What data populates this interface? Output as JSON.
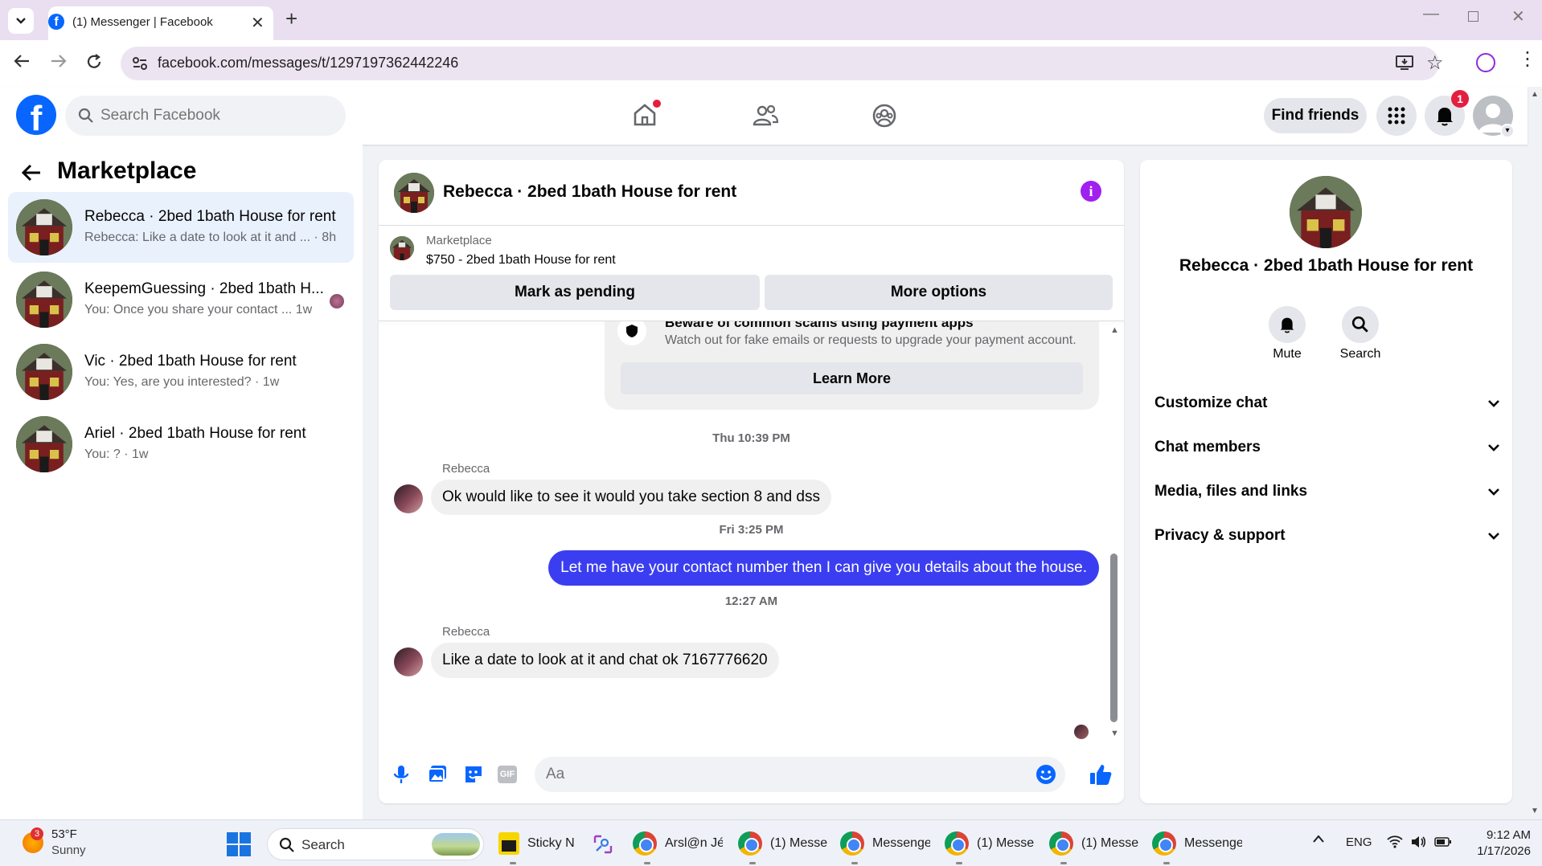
{
  "browser": {
    "tab_title": "(1) Messenger | Facebook",
    "url": "facebook.com/messages/t/1297197362442246"
  },
  "fb_header": {
    "search_placeholder": "Search Facebook",
    "find_friends_label": "Find friends",
    "notification_count": "1"
  },
  "left_panel": {
    "back_title": "Marketplace",
    "conversations": [
      {
        "title": "Rebecca · 2bed 1bath House for rent",
        "preview": "Rebecca: Like a date to look at it and ...",
        "time": "· 8h",
        "active": true
      },
      {
        "title": "KeepemGuessing · 2bed 1bath H...",
        "preview": "You: Once you share your contact ...",
        "time": "1w",
        "active": false
      },
      {
        "title": "Vic · 2bed 1bath House for rent",
        "preview": "You: Yes, are you interested?",
        "time": "· 1w",
        "active": false
      },
      {
        "title": "Ariel · 2bed 1bath House for rent",
        "preview": "You: ?",
        "time": "· 1w",
        "active": false
      }
    ]
  },
  "chat": {
    "header_title": "Rebecca · 2bed 1bath House for rent",
    "listing_source": "Marketplace",
    "listing_title": "$750 - 2bed 1bath House for rent",
    "mark_pending_label": "Mark as pending",
    "more_options_label": "More options",
    "safety_title": "Beware of common scams using payment apps",
    "safety_text": "Watch out for fake emails or requests to upgrade your payment account.",
    "learn_more_label": "Learn More",
    "messages": [
      {
        "timestamp": "Thu 10:39 PM",
        "sender": "Rebecca",
        "text": "Ok would like to see it would you take section 8 and dss",
        "direction": "in"
      },
      {
        "timestamp": "Fri 3:25 PM",
        "sender": "",
        "text": "Let me have your contact number then I can give you details about the house.",
        "direction": "out"
      },
      {
        "timestamp": "12:27 AM",
        "sender": "Rebecca",
        "text": "Like a date to look at it and chat ok 7167776620",
        "direction": "in"
      }
    ],
    "composer_placeholder": "Aa"
  },
  "info_panel": {
    "name": "Rebecca · 2bed 1bath House for rent",
    "mute_label": "Mute",
    "search_label": "Search",
    "sections": [
      "Customize chat",
      "Chat members",
      "Media, files and links",
      "Privacy & support"
    ]
  },
  "taskbar": {
    "weather_temp": "53°F",
    "weather_cond": "Sunny",
    "weather_badge": "3",
    "search_label": "Search",
    "apps": [
      "Sticky N",
      "Arsl@n Jé",
      "(1) Messe",
      "Messenge",
      "(1) Messe",
      "(1) Messe",
      "Messenge"
    ],
    "lang": "ENG",
    "time": "9:12 AM",
    "date": "1/17/2026"
  },
  "colors": {
    "fb_blue": "#0866ff",
    "outgoing_bubble": "#3a3ef0",
    "accent_purple": "#a020f0",
    "notification_red": "#e41e3f"
  }
}
